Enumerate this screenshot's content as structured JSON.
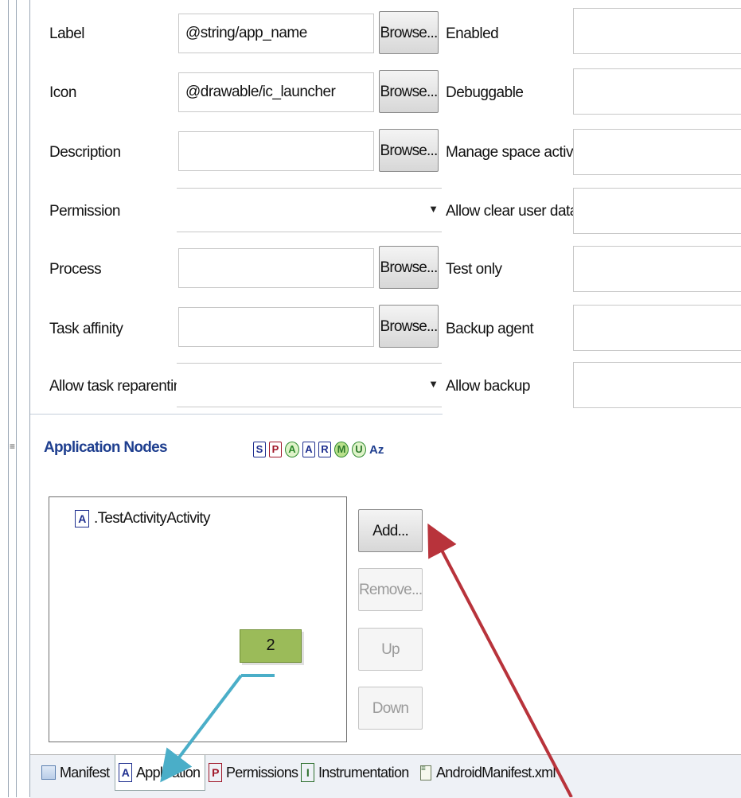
{
  "form": {
    "rows": [
      {
        "label": "Label",
        "value": "@string/app_name",
        "control": "browse"
      },
      {
        "label": "Icon",
        "value": "@drawable/ic_launcher",
        "control": "browse"
      },
      {
        "label": "Description",
        "value": "",
        "control": "browse"
      },
      {
        "label": "Permission",
        "value": "",
        "control": "combo"
      },
      {
        "label": "Process",
        "value": "",
        "control": "browse"
      },
      {
        "label": "Task affinity",
        "value": "",
        "control": "browse"
      },
      {
        "label": "Allow task reparenting",
        "value": "",
        "control": "combo"
      }
    ],
    "browse_label": "Browse...",
    "right_labels": [
      "Enabled",
      "Debuggable",
      "Manage space activity",
      "Allow clear user data",
      "Test only",
      "Backup agent",
      "Allow backup"
    ]
  },
  "app_nodes": {
    "title": "Application Nodes",
    "filters": [
      "S",
      "P",
      "A",
      "A",
      "R",
      "M",
      "U"
    ],
    "sort_label": "Az",
    "items": [
      {
        "icon": "A",
        "label": ".TestActivityActivity"
      }
    ],
    "buttons": {
      "add": "Add...",
      "remove": "Remove...",
      "up": "Up",
      "down": "Down"
    }
  },
  "callout": {
    "text": "2"
  },
  "tabs": [
    {
      "icon": "manifest-icon",
      "label": "Manifest"
    },
    {
      "icon": "A",
      "label": "Application"
    },
    {
      "icon": "P",
      "label": "Permissions"
    },
    {
      "icon": "I",
      "label": "Instrumentation"
    },
    {
      "icon": "xml-file-icon",
      "label": "AndroidManifest.xml"
    }
  ],
  "colors": {
    "section_title": "#1f3f8f",
    "callout": "#9bbb59",
    "blue_arrow": "#4aaec8",
    "red_arrow": "#b8333b"
  }
}
